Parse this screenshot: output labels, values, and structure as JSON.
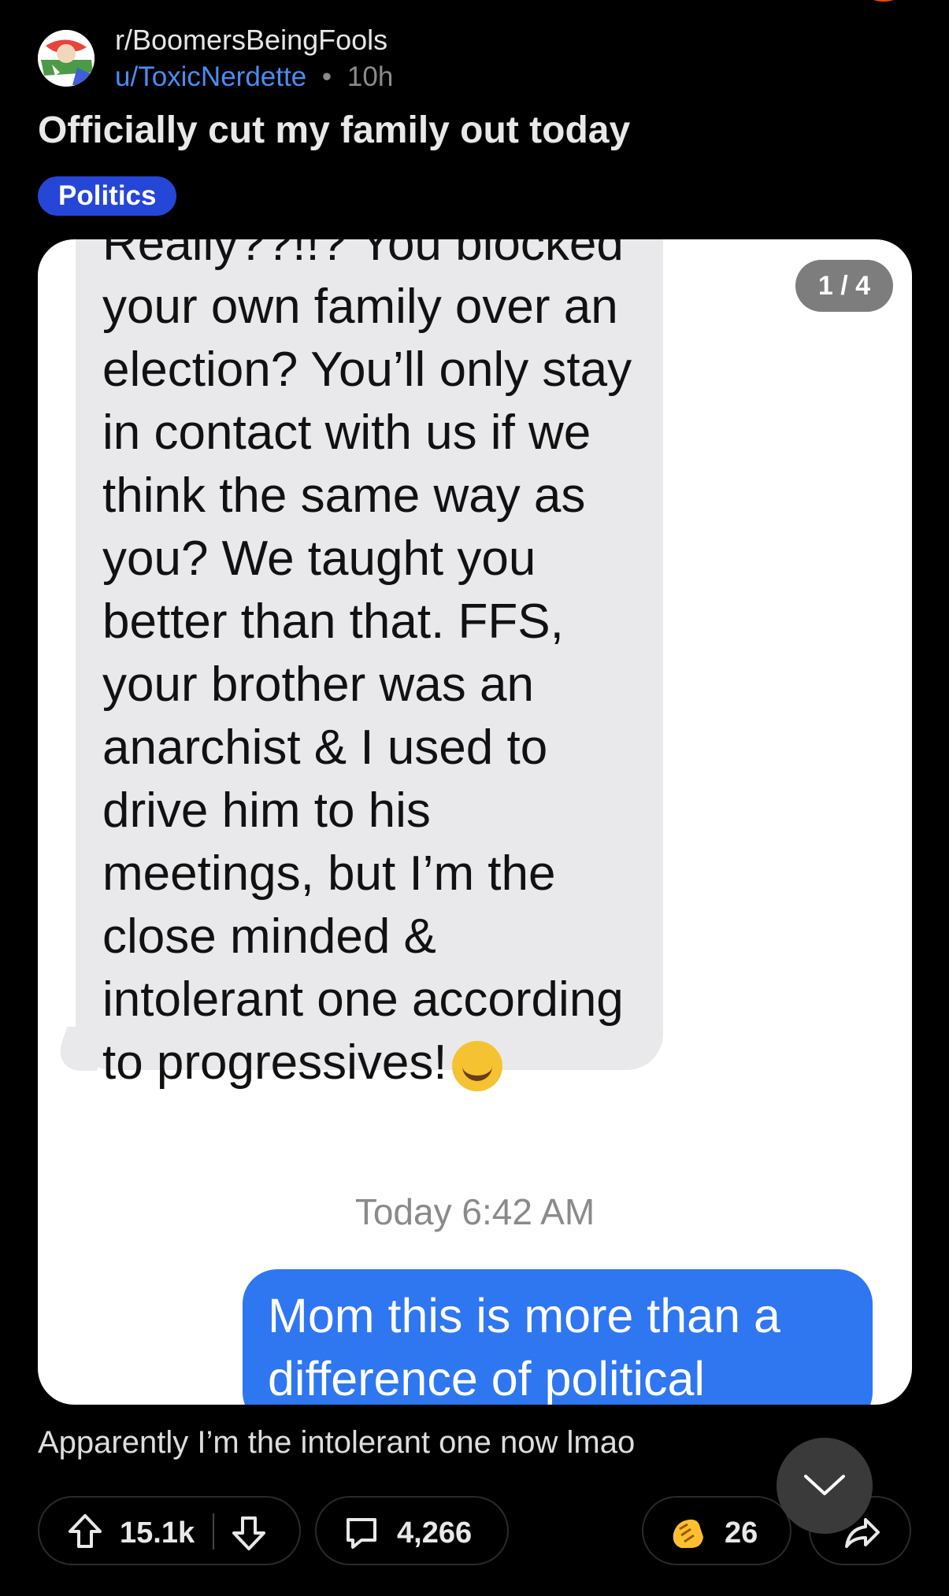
{
  "post": {
    "subreddit": "r/BoomersBeingFools",
    "username": "u/ToxicNerdette",
    "separator": "•",
    "age": "10h",
    "title": "Officially cut my family out today",
    "flair": "Politics",
    "caption": "Apparently I’m the intolerant one now lmao"
  },
  "gallery": {
    "counter": "1 / 4"
  },
  "screenshot": {
    "incoming_message": "Really??!!? You blocked\nyour own family over an\nelection? You’ll only stay\nin contact with us if we\nthink the same way as\nyou? We taught you\nbetter than that. FFS,\nyour brother was an\nanarchist & I used to\ndrive him to his\nmeetings, but I’m the\nclose minded &\nintolerant one according\nto progressives!",
    "timestamp": "Today 6:42 AM",
    "outgoing_message": "Mom this is more than a\ndifference of political"
  },
  "actions": {
    "upvotes": "15.1k",
    "comments": "4,266",
    "awards": "26"
  },
  "icons": {
    "upvote": "upvote-arrow-icon",
    "downvote": "downvote-arrow-icon",
    "comment": "comment-bubble-icon",
    "award": "clapping-hands-icon",
    "share": "share-arrow-icon",
    "collapse": "chevron-down-icon"
  },
  "colors": {
    "link": "#4a8df0",
    "flair_bg": "#2546d6",
    "outgoing_bubble": "#2f76f1",
    "incoming_bubble": "#e9e9eb"
  }
}
